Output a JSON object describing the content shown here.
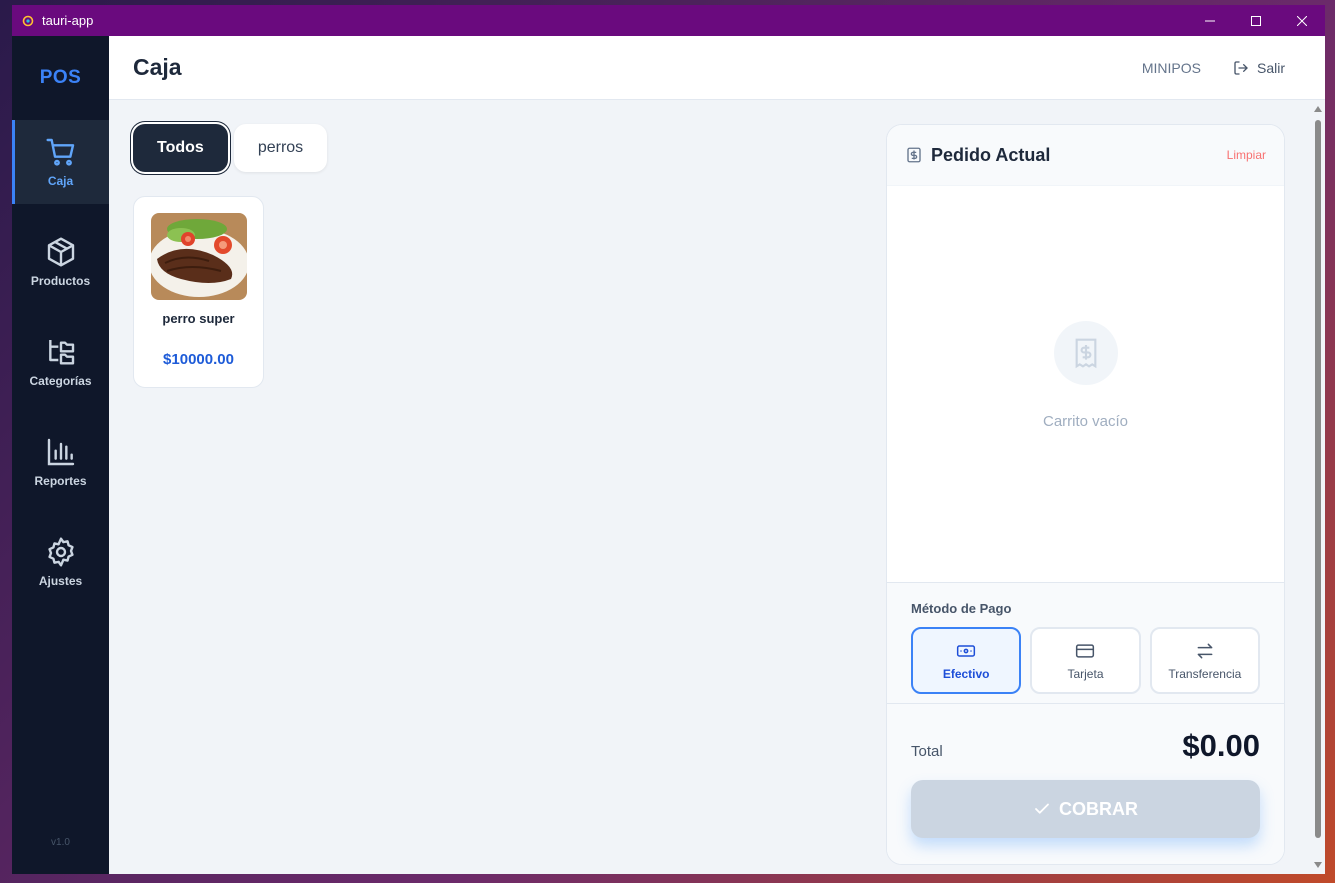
{
  "window": {
    "title": "tauri-app"
  },
  "sidebar": {
    "logo": "POS",
    "items": [
      {
        "label": "Caja",
        "icon": "cart-icon",
        "active": true
      },
      {
        "label": "Productos",
        "icon": "box-icon",
        "active": false
      },
      {
        "label": "Categorías",
        "icon": "folder-tree-icon",
        "active": false
      },
      {
        "label": "Reportes",
        "icon": "bar-chart-icon",
        "active": false
      },
      {
        "label": "Ajustes",
        "icon": "gear-icon",
        "active": false
      }
    ],
    "version": "v1.0"
  },
  "header": {
    "title": "Caja",
    "brand": "MINIPOS",
    "logout_label": "Salir"
  },
  "categories": [
    {
      "label": "Todos",
      "active": true
    },
    {
      "label": "perros",
      "active": false
    }
  ],
  "products": [
    {
      "name": "perro super",
      "price": "$10000.00"
    }
  ],
  "order": {
    "title": "Pedido Actual",
    "clear_label": "Limpiar",
    "empty_text": "Carrito vacío",
    "payment_label": "Método de Pago",
    "payment_methods": [
      {
        "label": "Efectivo",
        "icon": "cash-icon",
        "active": true
      },
      {
        "label": "Tarjeta",
        "icon": "card-icon",
        "active": false
      },
      {
        "label": "Transferencia",
        "icon": "transfer-icon",
        "active": false
      }
    ],
    "total_label": "Total",
    "total_value": "$0.00",
    "charge_label": "COBRAR"
  },
  "colors": {
    "titlebar": "#6a0a7e",
    "sidebar": "#0f172a",
    "accent": "#3b82f6",
    "price": "#1d5bd8"
  }
}
